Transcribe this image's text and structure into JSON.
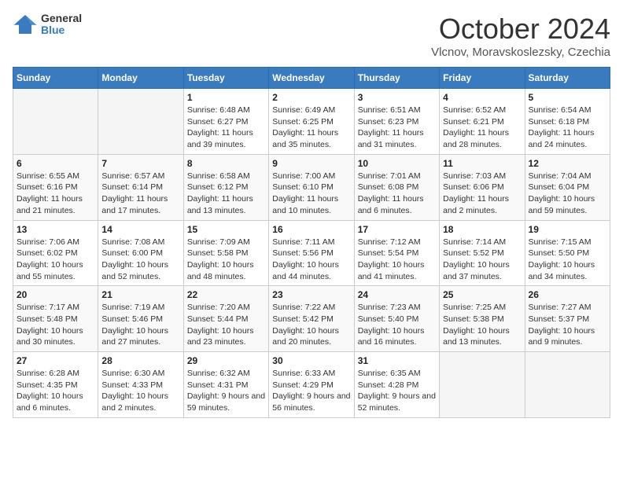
{
  "header": {
    "logo_general": "General",
    "logo_blue": "Blue",
    "month_title": "October 2024",
    "subtitle": "Vlcnov, Moravskoslezsky, Czechia"
  },
  "weekdays": [
    "Sunday",
    "Monday",
    "Tuesday",
    "Wednesday",
    "Thursday",
    "Friday",
    "Saturday"
  ],
  "weeks": [
    [
      {
        "day": "",
        "info": ""
      },
      {
        "day": "",
        "info": ""
      },
      {
        "day": "1",
        "info": "Sunrise: 6:48 AM\nSunset: 6:27 PM\nDaylight: 11 hours and 39 minutes."
      },
      {
        "day": "2",
        "info": "Sunrise: 6:49 AM\nSunset: 6:25 PM\nDaylight: 11 hours and 35 minutes."
      },
      {
        "day": "3",
        "info": "Sunrise: 6:51 AM\nSunset: 6:23 PM\nDaylight: 11 hours and 31 minutes."
      },
      {
        "day": "4",
        "info": "Sunrise: 6:52 AM\nSunset: 6:21 PM\nDaylight: 11 hours and 28 minutes."
      },
      {
        "day": "5",
        "info": "Sunrise: 6:54 AM\nSunset: 6:18 PM\nDaylight: 11 hours and 24 minutes."
      }
    ],
    [
      {
        "day": "6",
        "info": "Sunrise: 6:55 AM\nSunset: 6:16 PM\nDaylight: 11 hours and 21 minutes."
      },
      {
        "day": "7",
        "info": "Sunrise: 6:57 AM\nSunset: 6:14 PM\nDaylight: 11 hours and 17 minutes."
      },
      {
        "day": "8",
        "info": "Sunrise: 6:58 AM\nSunset: 6:12 PM\nDaylight: 11 hours and 13 minutes."
      },
      {
        "day": "9",
        "info": "Sunrise: 7:00 AM\nSunset: 6:10 PM\nDaylight: 11 hours and 10 minutes."
      },
      {
        "day": "10",
        "info": "Sunrise: 7:01 AM\nSunset: 6:08 PM\nDaylight: 11 hours and 6 minutes."
      },
      {
        "day": "11",
        "info": "Sunrise: 7:03 AM\nSunset: 6:06 PM\nDaylight: 11 hours and 2 minutes."
      },
      {
        "day": "12",
        "info": "Sunrise: 7:04 AM\nSunset: 6:04 PM\nDaylight: 10 hours and 59 minutes."
      }
    ],
    [
      {
        "day": "13",
        "info": "Sunrise: 7:06 AM\nSunset: 6:02 PM\nDaylight: 10 hours and 55 minutes."
      },
      {
        "day": "14",
        "info": "Sunrise: 7:08 AM\nSunset: 6:00 PM\nDaylight: 10 hours and 52 minutes."
      },
      {
        "day": "15",
        "info": "Sunrise: 7:09 AM\nSunset: 5:58 PM\nDaylight: 10 hours and 48 minutes."
      },
      {
        "day": "16",
        "info": "Sunrise: 7:11 AM\nSunset: 5:56 PM\nDaylight: 10 hours and 44 minutes."
      },
      {
        "day": "17",
        "info": "Sunrise: 7:12 AM\nSunset: 5:54 PM\nDaylight: 10 hours and 41 minutes."
      },
      {
        "day": "18",
        "info": "Sunrise: 7:14 AM\nSunset: 5:52 PM\nDaylight: 10 hours and 37 minutes."
      },
      {
        "day": "19",
        "info": "Sunrise: 7:15 AM\nSunset: 5:50 PM\nDaylight: 10 hours and 34 minutes."
      }
    ],
    [
      {
        "day": "20",
        "info": "Sunrise: 7:17 AM\nSunset: 5:48 PM\nDaylight: 10 hours and 30 minutes."
      },
      {
        "day": "21",
        "info": "Sunrise: 7:19 AM\nSunset: 5:46 PM\nDaylight: 10 hours and 27 minutes."
      },
      {
        "day": "22",
        "info": "Sunrise: 7:20 AM\nSunset: 5:44 PM\nDaylight: 10 hours and 23 minutes."
      },
      {
        "day": "23",
        "info": "Sunrise: 7:22 AM\nSunset: 5:42 PM\nDaylight: 10 hours and 20 minutes."
      },
      {
        "day": "24",
        "info": "Sunrise: 7:23 AM\nSunset: 5:40 PM\nDaylight: 10 hours and 16 minutes."
      },
      {
        "day": "25",
        "info": "Sunrise: 7:25 AM\nSunset: 5:38 PM\nDaylight: 10 hours and 13 minutes."
      },
      {
        "day": "26",
        "info": "Sunrise: 7:27 AM\nSunset: 5:37 PM\nDaylight: 10 hours and 9 minutes."
      }
    ],
    [
      {
        "day": "27",
        "info": "Sunrise: 6:28 AM\nSunset: 4:35 PM\nDaylight: 10 hours and 6 minutes."
      },
      {
        "day": "28",
        "info": "Sunrise: 6:30 AM\nSunset: 4:33 PM\nDaylight: 10 hours and 2 minutes."
      },
      {
        "day": "29",
        "info": "Sunrise: 6:32 AM\nSunset: 4:31 PM\nDaylight: 9 hours and 59 minutes."
      },
      {
        "day": "30",
        "info": "Sunrise: 6:33 AM\nSunset: 4:29 PM\nDaylight: 9 hours and 56 minutes."
      },
      {
        "day": "31",
        "info": "Sunrise: 6:35 AM\nSunset: 4:28 PM\nDaylight: 9 hours and 52 minutes."
      },
      {
        "day": "",
        "info": ""
      },
      {
        "day": "",
        "info": ""
      }
    ]
  ]
}
